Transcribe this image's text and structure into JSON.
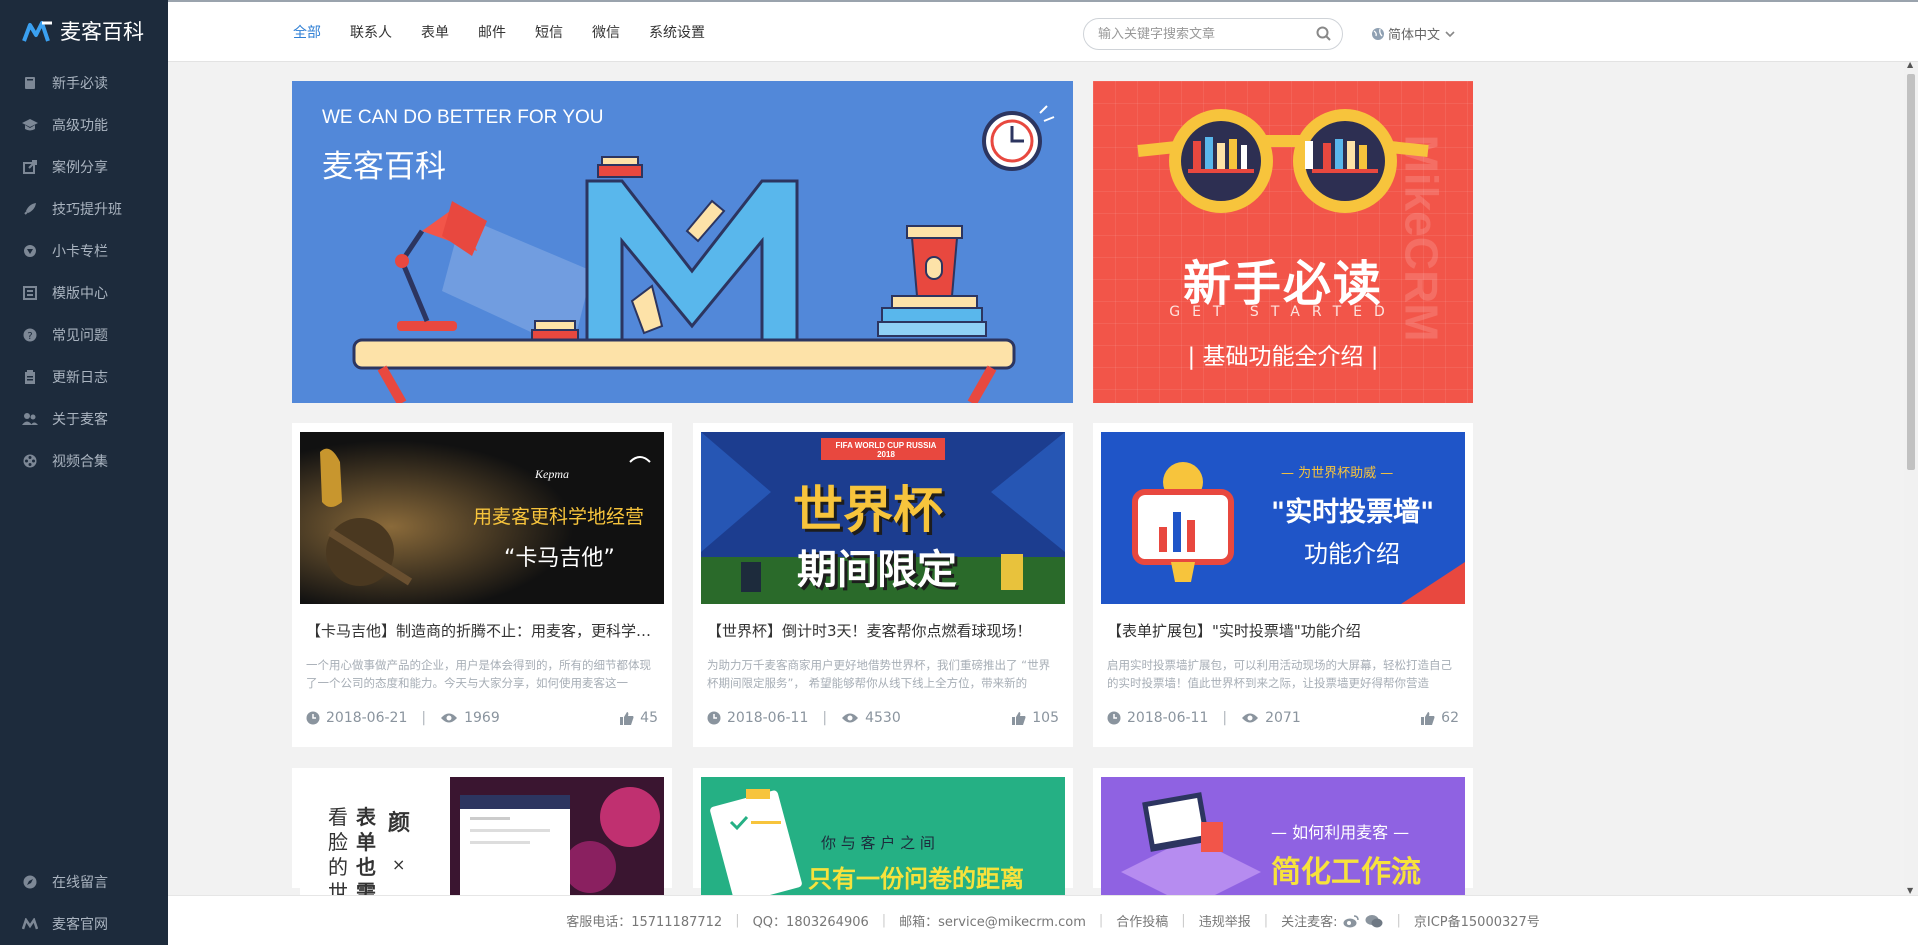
{
  "sidebar": {
    "brand": "麦客百科",
    "items": [
      {
        "label": "新手必读",
        "icon": "book-icon"
      },
      {
        "label": "高级功能",
        "icon": "graduation-cap-icon"
      },
      {
        "label": "案例分享",
        "icon": "share-icon"
      },
      {
        "label": "技巧提升班",
        "icon": "rocket-icon"
      },
      {
        "label": "小卡专栏",
        "icon": "badge-icon"
      },
      {
        "label": "模版中心",
        "icon": "template-icon"
      },
      {
        "label": "常见问题",
        "icon": "question-icon"
      },
      {
        "label": "更新日志",
        "icon": "clipboard-icon"
      },
      {
        "label": "关于麦客",
        "icon": "users-icon"
      },
      {
        "label": "视频合集",
        "icon": "film-icon"
      }
    ],
    "bottom_items": [
      {
        "label": "在线留言",
        "icon": "compass-icon"
      },
      {
        "label": "麦客官网",
        "icon": "mikecrm-logo-icon"
      }
    ]
  },
  "topbar": {
    "tabs": [
      "全部",
      "联系人",
      "表单",
      "邮件",
      "短信",
      "微信",
      "系统设置"
    ],
    "active_tab": 0,
    "search_placeholder": "输入关键字搜索文章",
    "language": "简体中文"
  },
  "banners": {
    "main": {
      "eng": "WE CAN DO BETTER FOR YOU",
      "cn": "麦客百科"
    },
    "side": {
      "title": "新手必读",
      "sub": "GET STARTED",
      "desc": "| 基础功能全介绍 |",
      "watermark": "MikeCRM"
    }
  },
  "articles": [
    {
      "thumb_text_1": "用麦客更科学地经营",
      "thumb_text_2": "“卡马吉他”",
      "thumb_brand": "Kepma",
      "title": "【卡马吉他】制造商的折腾不止：用麦客，更科学地经营",
      "desc": "一个用心做事做产品的企业，用户是体会得到的，所有的细节都体现了一个公司的态度和能力。今天与大家分享，如何使用麦客这一",
      "date": "2018-06-21",
      "views": "1969",
      "likes": "45"
    },
    {
      "thumb_text_1": "世界杯",
      "thumb_text_2": "期间限定",
      "thumb_brand": "FIFA WORLD CUP RUSSIA 2018",
      "title": "【世界杯】倒计时3天！麦客帮你点燃看球现场！",
      "desc": "为助力万千麦客商家用户更好地借势世界杯，我们重磅推出了 “世界杯期间限定服务”， 希望能够帮你从线下线上全方位，带来新的",
      "date": "2018-06-11",
      "views": "4530",
      "likes": "105"
    },
    {
      "thumb_text_1": "— 为世界杯助威 —",
      "thumb_text_2": "\"实时投票墙\"",
      "thumb_text_3": "功能介绍",
      "title": "【表单扩展包】\"实时投票墙\"功能介绍",
      "desc": "启用实时投票墙扩展包，可以利用活动现场的大屏幕，轻松打造自己的实时投票墙！值此世界杯到来之际，让投票墙更好得帮你营造",
      "date": "2018-06-11",
      "views": "2071",
      "likes": "62"
    }
  ],
  "articles_row2": [
    {
      "thumb_text_1": "看脸的世",
      "thumb_text_2": "表单也需",
      "thumb_text_3": "颜",
      "thumb_text_4": "×"
    },
    {
      "thumb_text_1": "你 与 客 户 之 间",
      "thumb_text_2": "只有一份问卷的距离"
    },
    {
      "thumb_text_1": "— 如何利用麦客 —",
      "thumb_text_2": "简化工作流"
    }
  ],
  "footer": {
    "phone": "客服电话：15711187712",
    "qq": "QQ：1803264906",
    "email": "邮箱：service@mikecrm.com",
    "cooperate": "合作投稿",
    "report": "违规举报",
    "follow": "关注麦客:",
    "icp": "京ICP备15000327号"
  },
  "colors": {
    "sidebar_bg": "#1d2b3c",
    "accent": "#2f7fd4",
    "banner_blue": "#5288d9",
    "banner_red": "#f25549"
  }
}
